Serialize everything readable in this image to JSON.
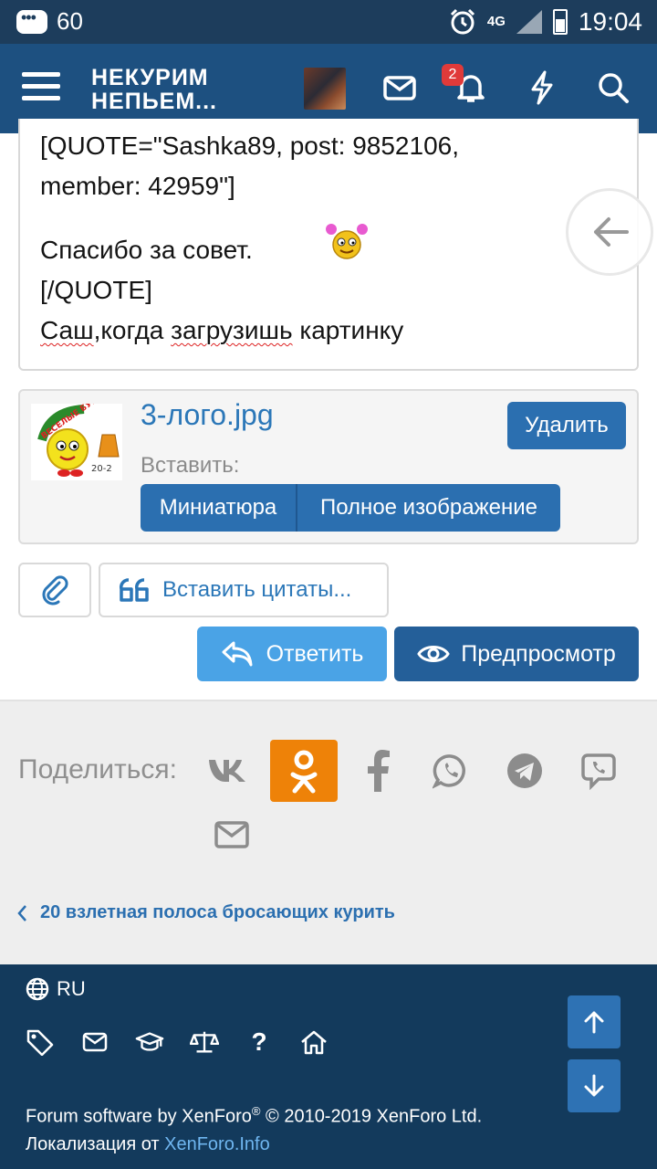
{
  "status_bar": {
    "notification_count": "60",
    "network": "4G",
    "time": "19:04"
  },
  "nav": {
    "logo_line1": "НЕКУРИМ",
    "logo_line2": "НЕПЬЕМ...",
    "alerts_badge": "2"
  },
  "editor": {
    "line1": "[QUOTE=\"Sashka89, post: 9852106,",
    "line2": "member: 42959\"]",
    "line3": "Спасибо за совет.",
    "line4": "[/QUOTE]",
    "line5_word1": "Саш",
    "line5_word2": ",когда ",
    "line5_word3": "загрузишь",
    "line5_word4": " картинку"
  },
  "attachment": {
    "filename": "3-лого.jpg",
    "delete_label": "Удалить",
    "insert_label": "Вставить:",
    "thumbnail_label": "Миниатюра",
    "full_image_label": "Полное изображение",
    "thumb_text": "ВЕСЕЛЫЕ БУБЕНЦЫ",
    "thumb_number": "20-2"
  },
  "tools": {
    "insert_quotes_label": "Вставить цитаты..."
  },
  "actions": {
    "reply_label": "Ответить",
    "preview_label": "Предпросмотр"
  },
  "share": {
    "label": "Поделиться:",
    "networks": [
      "vk-icon",
      "odnoklassniki-icon",
      "facebook-icon",
      "whatsapp-icon",
      "telegram-icon",
      "viber-icon",
      "email-icon"
    ]
  },
  "breadcrumb": {
    "back_label": "20 взлетная полоса бросающих курить"
  },
  "footer": {
    "language": "RU",
    "copyright_prefix": "Forum software by XenForo",
    "copyright_reg": "®",
    "copyright_suffix": " © 2010-2019 XenForo Ltd.",
    "localization_prefix": "Локализация от ",
    "localization_link": "XenForo.Info"
  },
  "colors": {
    "nav": "#1d5080",
    "status": "#1d3d5c",
    "footer": "#133a5c",
    "accent": "#2b6fb0",
    "ok_orange": "#ee8208"
  }
}
